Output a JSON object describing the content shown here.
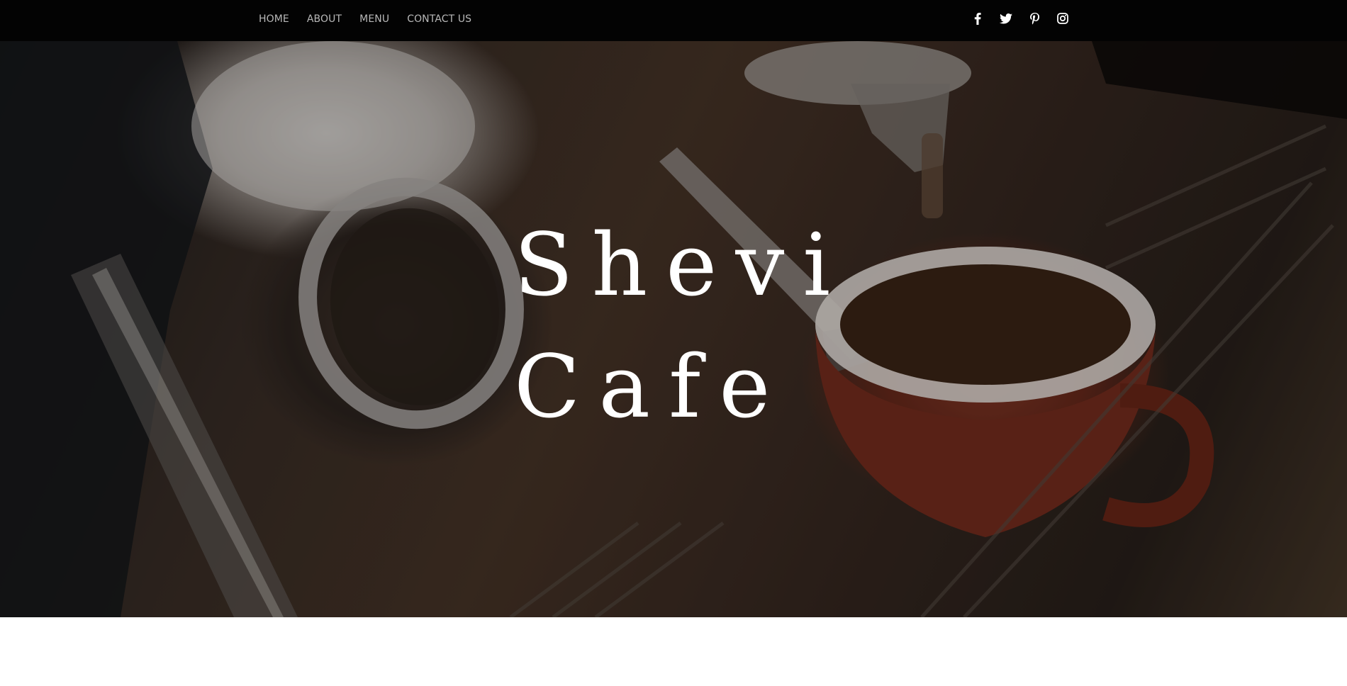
{
  "nav": {
    "items": [
      {
        "label": "HOME"
      },
      {
        "label": "ABOUT"
      },
      {
        "label": "MENU"
      },
      {
        "label": "CONTACT US"
      }
    ]
  },
  "social": {
    "icons": [
      "facebook-icon",
      "twitter-icon",
      "pinterest-icon",
      "instagram-icon"
    ]
  },
  "hero": {
    "title_line1": "Shevi",
    "title_line2": "Cafe",
    "background": "espresso-machine-coffee-cup-photo"
  },
  "colors": {
    "topbar": "#030303",
    "nav_text": "#b8b8b8",
    "title": "#ffffff",
    "page_bg": "#ffffff"
  }
}
